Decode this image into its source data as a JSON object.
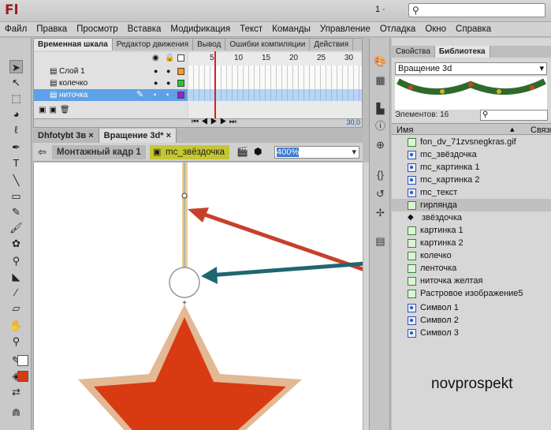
{
  "app": {
    "logo": "Fl",
    "workspace": "1 ·",
    "search_placeholder": "⚲"
  },
  "menu": [
    "Файл",
    "Правка",
    "Просмотр",
    "Вставка",
    "Модификация",
    "Текст",
    "Команды",
    "Управление",
    "Отладка",
    "Окно",
    "Справка"
  ],
  "timeline": {
    "tabs": [
      "Временная шкала",
      "Редактор движения",
      "Вывод",
      "Ошибки компиляции",
      "Действия"
    ],
    "frame_numbers": [
      "5",
      "10",
      "15",
      "20",
      "25",
      "30"
    ],
    "layers": [
      {
        "name": "Слой 1",
        "color": "#ff9922",
        "selected": false
      },
      {
        "name": "колечко",
        "color": "#22cc22",
        "selected": false
      },
      {
        "name": "ниточка",
        "color": "#9922cc",
        "selected": true
      }
    ],
    "fps": "30,0"
  },
  "document_tabs": [
    "Dhfotybt 3в",
    "Вращение 3d*"
  ],
  "edit_bar": {
    "scene": "Монтажный кадр 1",
    "symbol": "mc_звёздочка",
    "zoom": "400%"
  },
  "library": {
    "tabs": [
      "Свойства",
      "Библиотека"
    ],
    "document": "Вращение 3d",
    "element_count": "Элементов: 16",
    "columns": [
      "Имя",
      "Связь"
    ],
    "items": [
      {
        "name": "fon_dv_71zvsnegkras.gif",
        "kind": "bitmap"
      },
      {
        "name": "mc_звёздочка",
        "kind": "movieclip"
      },
      {
        "name": "mc_картинка 1",
        "kind": "movieclip"
      },
      {
        "name": "mc_картинка 2",
        "kind": "movieclip"
      },
      {
        "name": "mc_текст",
        "kind": "movieclip"
      },
      {
        "name": "гирлянда",
        "kind": "bitmap",
        "highlight": true
      },
      {
        "name": "звёздочка",
        "kind": "graphic"
      },
      {
        "name": "картинка 1",
        "kind": "bitmap"
      },
      {
        "name": "картинка 2",
        "kind": "bitmap"
      },
      {
        "name": "колечко",
        "kind": "bitmap"
      },
      {
        "name": "ленточка",
        "kind": "bitmap"
      },
      {
        "name": "ниточка желтая",
        "kind": "bitmap"
      },
      {
        "name": "Растровое изображение5",
        "kind": "bitmap"
      },
      {
        "name": "Символ 1",
        "kind": "movieclip"
      },
      {
        "name": "Символ 2",
        "kind": "movieclip"
      },
      {
        "name": "Символ 3",
        "kind": "movieclip"
      }
    ]
  },
  "watermark": "novprospekt",
  "colors": {
    "accent_red": "#c8402c",
    "arrow_teal": "#1f6670",
    "selection": "#5fa1e8",
    "fill_color": "#d83a12"
  }
}
